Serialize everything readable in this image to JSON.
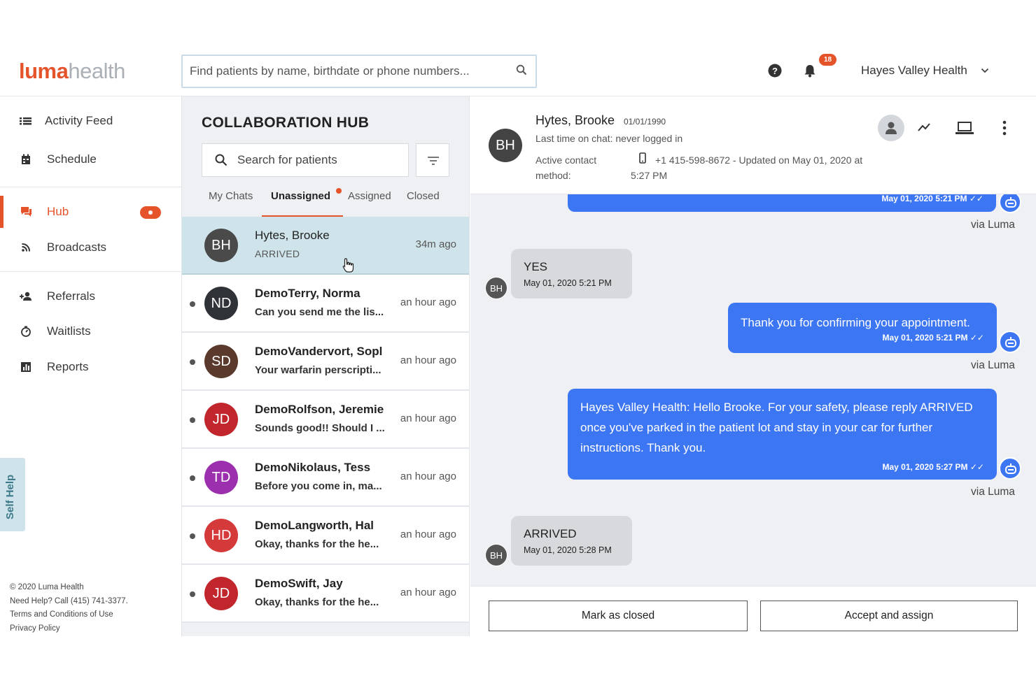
{
  "header": {
    "logo_part1": "luma",
    "logo_part2": "health",
    "search_placeholder": "Find patients by name, birthdate or phone numbers...",
    "notification_count": "18",
    "org_name": "Hayes Valley Health"
  },
  "sidebar": {
    "items": [
      {
        "label": "Activity Feed",
        "icon": "list-icon"
      },
      {
        "label": "Schedule",
        "icon": "calendar-icon"
      },
      {
        "label": "Hub",
        "icon": "chat-icon",
        "active": true
      },
      {
        "label": "Broadcasts",
        "icon": "rss-icon"
      },
      {
        "label": "Referrals",
        "icon": "add-person-icon"
      },
      {
        "label": "Waitlists",
        "icon": "timer-icon"
      },
      {
        "label": "Reports",
        "icon": "bar-chart-icon"
      }
    ],
    "self_help": "Self Help",
    "footer": {
      "copyright": "© 2020 Luma Health",
      "need_help": "Need Help? Call (415) 741-3377.",
      "terms": "Terms and Conditions of Use",
      "privacy": "Privacy Policy"
    }
  },
  "hub": {
    "title": "COLLABORATION HUB",
    "search_placeholder": "Search for patients",
    "tabs": [
      "My Chats",
      "Unassigned",
      "Assigned",
      "Closed"
    ],
    "active_tab": "Unassigned",
    "chats": [
      {
        "initials": "BH",
        "name": "Hytes, Brooke",
        "preview": "ARRIVED",
        "time": "34m ago",
        "color": "#4a4a4a",
        "selected": true
      },
      {
        "initials": "ND",
        "name": "DemoTerry, Norma",
        "preview": "Can you send me the lis...",
        "time": "an hour ago",
        "color": "#2f3337"
      },
      {
        "initials": "SD",
        "name": "DemoVandervort, Sopl",
        "preview": "Your warfarin perscripti...",
        "time": "an hour ago",
        "color": "#5a3a2c"
      },
      {
        "initials": "JD",
        "name": "DemoRolfson, Jeremie",
        "preview": "Sounds good!! Should I ...",
        "time": "an hour ago",
        "color": "#c0262b"
      },
      {
        "initials": "TD",
        "name": "DemoNikolaus, Tess",
        "preview": "Before you come in, ma...",
        "time": "an hour ago",
        "color": "#9b2fae"
      },
      {
        "initials": "HD",
        "name": "DemoLangworth, Hal",
        "preview": "Okay, thanks for the he...",
        "time": "an hour ago",
        "color": "#d53a3a"
      },
      {
        "initials": "JD",
        "name": "DemoSwift, Jay",
        "preview": "Okay, thanks for the he...",
        "time": "an hour ago",
        "color": "#c0262b"
      }
    ]
  },
  "conversation": {
    "patient": {
      "initials": "BH",
      "name": "Hytes, Brooke",
      "dob": "01/01/1990",
      "last_chat": "Last time on chat: never logged in",
      "active_contact_label": "Active contact method:",
      "phone_info": "+1 415-598-8672 - Updated on May 01, 2020 at 5:27 PM"
    },
    "messages": [
      {
        "dir": "out",
        "text": "",
        "meta": "May 01, 2020 5:21 PM ✓✓",
        "via": "via Luma"
      },
      {
        "dir": "in",
        "text": "YES",
        "meta": "May 01, 2020 5:21 PM",
        "initials": "BH"
      },
      {
        "dir": "out",
        "text": "Thank you for confirming your appointment.",
        "meta": "May 01, 2020 5:21 PM ✓✓",
        "via": "via Luma"
      },
      {
        "dir": "out",
        "text": "Hayes Valley Health: Hello Brooke. For your safety, please reply ARRIVED once you've parked in the patient lot and stay in your car for further instructions. Thank you.",
        "meta": "May 01, 2020 5:27 PM ✓✓",
        "via": "via Luma"
      },
      {
        "dir": "in",
        "text": "ARRIVED",
        "meta": "May 01, 2020 5:28 PM",
        "initials": "BH"
      }
    ],
    "actions": {
      "mark_closed": "Mark as closed",
      "accept_assign": "Accept and assign"
    }
  },
  "colors": {
    "brand_orange": "#e5532b",
    "message_blue": "#3d76f2",
    "selected_row": "#cfe4ea"
  }
}
